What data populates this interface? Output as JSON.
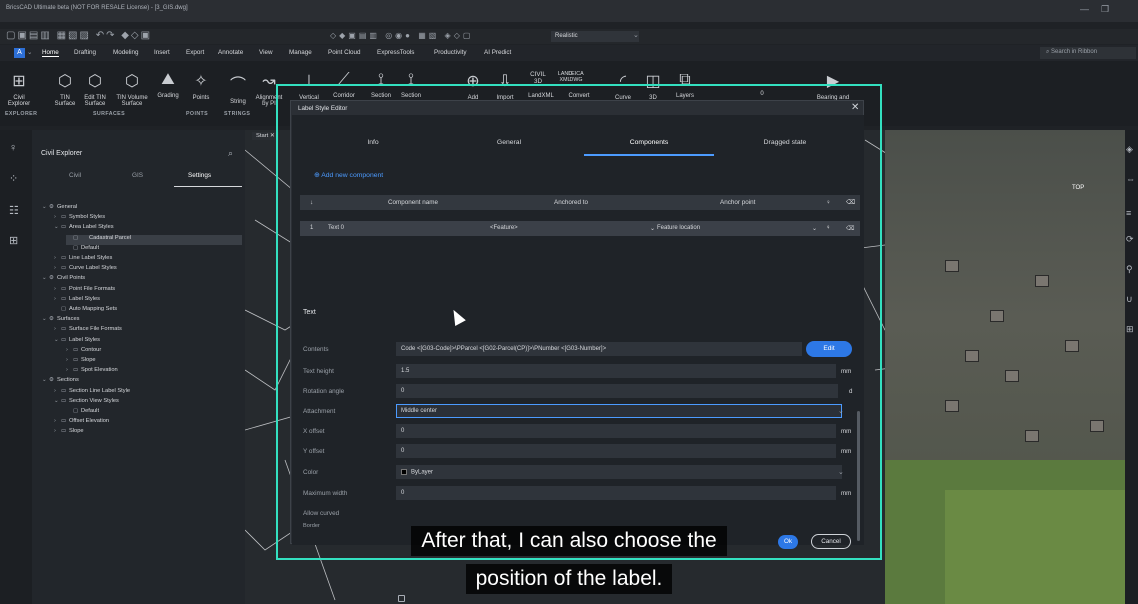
{
  "window": {
    "title": "BricsCAD Ultimate beta (NOT FOR RESALE License) - [3_GIS.dwg]"
  },
  "qat": {
    "visual_style": "Realistic"
  },
  "menubar": {
    "items": [
      "Home",
      "Drafting",
      "Modeling",
      "Insert",
      "Export",
      "Annotate",
      "View",
      "Manage",
      "Point Cloud",
      "ExpressTools",
      "Productivity",
      "AI Predict"
    ],
    "search_placeholder": "Search in Ribbon"
  },
  "ribbon": {
    "buttons": [
      {
        "label": "Civil\nExplorer"
      },
      {
        "label": "TIN\nSurface"
      },
      {
        "label": "Edit TIN\nSurface"
      },
      {
        "label": "TIN Volume\nSurface"
      },
      {
        "label": "Grading"
      },
      {
        "label": "Points"
      },
      {
        "label": "String"
      },
      {
        "label": "Alignment\nby PI"
      },
      {
        "label": "Vertical"
      },
      {
        "label": "Corridor"
      },
      {
        "label": "Section"
      },
      {
        "label": "Section"
      },
      {
        "label": "Add"
      },
      {
        "label": "Import"
      },
      {
        "label": "CIVIL\n3D"
      },
      {
        "label": "LAND\nXML"
      },
      {
        "label": "LandXML"
      },
      {
        "label": "LEICA\nDWG"
      },
      {
        "label": "Convert"
      },
      {
        "label": "Curve"
      },
      {
        "label": "3D"
      },
      {
        "label": "Layers"
      },
      {
        "label": "0"
      },
      {
        "label": "Bearing and"
      }
    ],
    "panels": [
      "EXPLORER",
      "SURFACES",
      "POINTS",
      "STRINGS"
    ]
  },
  "civil_explorer": {
    "title": "Civil Explorer",
    "tabs": [
      "Civil",
      "GIS",
      "Settings"
    ],
    "active_tab": "Settings",
    "tree": [
      {
        "label": "General",
        "level": 0,
        "expanded": true
      },
      {
        "label": "Symbol Styles",
        "level": 1,
        "expanded": false
      },
      {
        "label": "Area Label Styles",
        "level": 1,
        "expanded": true
      },
      {
        "label": "Cadastral Parcel",
        "level": 2,
        "selected": true
      },
      {
        "label": "Default",
        "level": 2
      },
      {
        "label": "Line Label Styles",
        "level": 1,
        "expanded": false
      },
      {
        "label": "Curve Label Styles",
        "level": 1,
        "expanded": false
      },
      {
        "label": "Civil Points",
        "level": 0,
        "expanded": true
      },
      {
        "label": "Point File Formats",
        "level": 1,
        "expanded": false
      },
      {
        "label": "Label Styles",
        "level": 1,
        "expanded": false
      },
      {
        "label": "Auto Mapping Sets",
        "level": 1
      },
      {
        "label": "Surfaces",
        "level": 0,
        "expanded": true
      },
      {
        "label": "Surface File Formats",
        "level": 1,
        "expanded": false
      },
      {
        "label": "Label Styles",
        "level": 1,
        "expanded": true
      },
      {
        "label": "Contour",
        "level": 2,
        "expanded": false
      },
      {
        "label": "Slope",
        "level": 2,
        "expanded": false
      },
      {
        "label": "Spot Elevation",
        "level": 2,
        "expanded": false
      },
      {
        "label": "Sections",
        "level": 0,
        "expanded": true
      },
      {
        "label": "Section Line Label Style",
        "level": 1,
        "expanded": false
      },
      {
        "label": "Section View Styles",
        "level": 1,
        "expanded": true
      },
      {
        "label": "Default",
        "level": 2
      },
      {
        "label": "Offset Elevation",
        "level": 1,
        "expanded": false
      },
      {
        "label": "Slope",
        "level": 1,
        "expanded": false
      }
    ]
  },
  "start_tab": "Start",
  "dialog": {
    "title": "Label Style Editor",
    "tabs": [
      "Info",
      "General",
      "Components",
      "Dragged state"
    ],
    "active_tab": "Components",
    "add_component": "Add new component",
    "table": {
      "headers": [
        "Component name",
        "Anchored to",
        "Anchor point"
      ],
      "rows": [
        {
          "index": "1",
          "name": "Text 0",
          "anchored_to": "<Feature>",
          "anchor_point": "Feature location"
        }
      ]
    },
    "section_title": "Text",
    "properties": [
      {
        "label": "Contents",
        "value": "Code <[G03-Code]>\\PParcel <[G02-Parcel(CP)]>\\PNumber <[G03-Number]>",
        "unit": ""
      },
      {
        "label": "Text height",
        "value": "1.5",
        "unit": "mm"
      },
      {
        "label": "Rotation angle",
        "value": "0",
        "unit": "d"
      },
      {
        "label": "Attachment",
        "value": "Middle center",
        "unit": ""
      },
      {
        "label": "X offset",
        "value": "0",
        "unit": "mm"
      },
      {
        "label": "Y offset",
        "value": "0",
        "unit": "mm"
      },
      {
        "label": "Color",
        "value": "ByLayer",
        "unit": ""
      },
      {
        "label": "Maximum width",
        "value": "0",
        "unit": "mm"
      },
      {
        "label": "Allow curved",
        "value": "",
        "unit": ""
      },
      {
        "label": "Border",
        "value": "",
        "unit": ""
      }
    ],
    "edit_label": "Edit",
    "ok_label": "Ok",
    "cancel_label": "Cancel"
  },
  "viewcube_label": "TOP",
  "caption": {
    "line1": "After that, I can also choose the",
    "line2": "position of the label."
  },
  "colors": {
    "accent": "#2d78e6",
    "highlight_frame": "#33e0c0"
  }
}
